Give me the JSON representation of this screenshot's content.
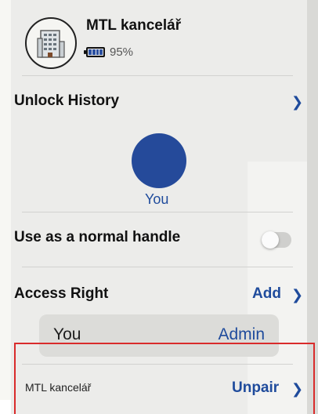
{
  "device": {
    "name": "MTL kancelář",
    "battery_percent": "95%",
    "battery_level": 0.95,
    "icon": "building-icon"
  },
  "unlock_history": {
    "label": "Unlock History",
    "user_label": "You"
  },
  "normal_handle": {
    "label": "Use as a normal handle",
    "enabled": false
  },
  "access_right": {
    "label": "Access Right",
    "add_label": "Add",
    "users": [
      {
        "name": "You",
        "role": "Admin"
      }
    ]
  },
  "paired_lock": {
    "name": "MTL kancelář",
    "unpair_label": "Unpair"
  },
  "colors": {
    "accent": "#1f4b9c",
    "highlight": "#d92b2b"
  }
}
